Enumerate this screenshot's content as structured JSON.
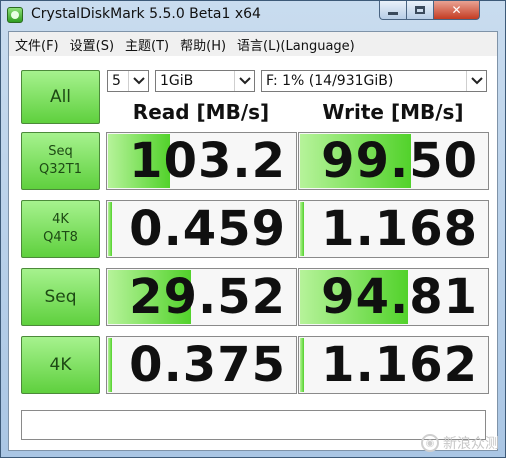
{
  "window": {
    "title": "CrystalDiskMark 5.5.0 Beta1 x64",
    "icons": [
      "app-icon",
      "minimize-icon",
      "maximize-icon",
      "close-icon"
    ]
  },
  "menu": [
    "文件(F)",
    "设置(S)",
    "主题(T)",
    "帮助(H)",
    "语言(L)(Language)"
  ],
  "controls": {
    "all_label": "All",
    "count": "5",
    "size": "1GiB",
    "drive": "F: 1% (14/931GiB)"
  },
  "headers": {
    "read": "Read [MB/s]",
    "write": "Write [MB/s]"
  },
  "tests": [
    {
      "label_line1": "Seq",
      "label_line2": "Q32T1",
      "read": "103.2",
      "write": "99.50",
      "read_fill": 0.34,
      "write_fill": 0.6
    },
    {
      "label_line1": "4K",
      "label_line2": "Q4T8",
      "read": "0.459",
      "write": "1.168",
      "read_fill": 0.03,
      "write_fill": 0.03
    },
    {
      "label_line1": "Seq",
      "label_line2": "",
      "read": "29.52",
      "write": "94.81",
      "read_fill": 0.45,
      "write_fill": 0.58
    },
    {
      "label_line1": "4K",
      "label_line2": "",
      "read": "0.375",
      "write": "1.162",
      "read_fill": 0.03,
      "write_fill": 0.03
    }
  ],
  "comment": "",
  "watermark": "新浪众测",
  "colors": {
    "accent_green": "#5fd03e",
    "fill_light": "#b6f39a",
    "title_bg": "#bcd3ea"
  }
}
